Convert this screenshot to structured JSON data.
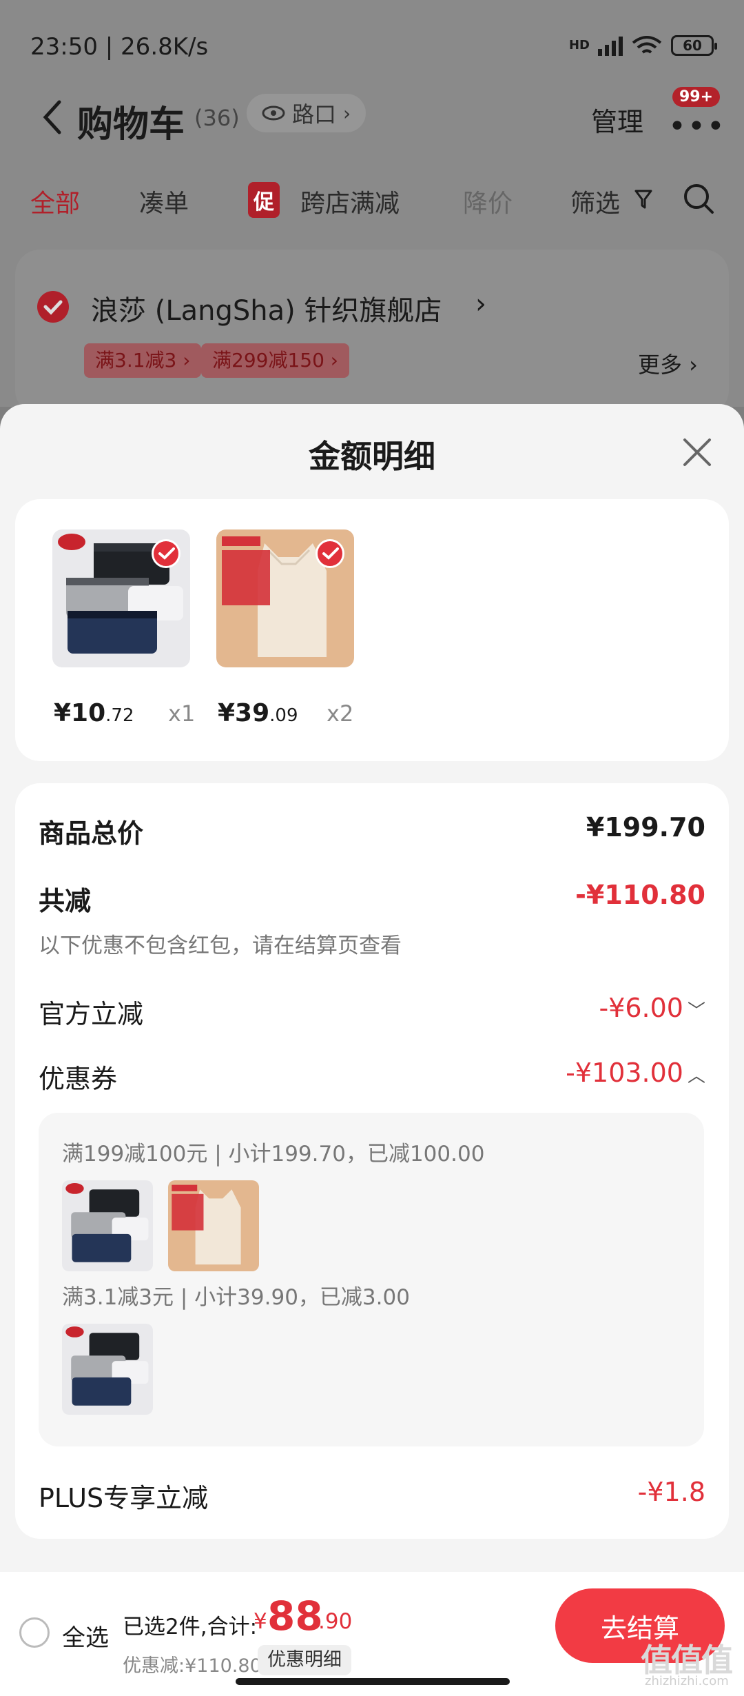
{
  "status": {
    "time_speed": "23:50 | 26.8K/s",
    "hd": "HD",
    "battery": "60"
  },
  "header": {
    "title": "购物车",
    "count": "(36)",
    "location": "路口",
    "manage": "管理",
    "badge": "99+"
  },
  "filters": {
    "all": "全部",
    "combine": "凑单",
    "promo_icon": "促",
    "promo": "跨店满减",
    "price_drop": "降价",
    "filter": "筛选"
  },
  "shop": {
    "name": "浪莎 (LangSha) 针织旗舰店",
    "coupons": [
      "满3.1减3 ›",
      "满299减150 ›"
    ],
    "more": "更多 ›"
  },
  "sheet": {
    "title": "金额明细",
    "products": [
      {
        "price_int": "¥10",
        "price_dec": ".72",
        "qty": "x1"
      },
      {
        "price_int": "¥39",
        "price_dec": ".09",
        "qty": "x2"
      }
    ],
    "total_label": "商品总价",
    "total_value": "¥199.70",
    "discount_label": "共减",
    "discount_value": "-¥110.80",
    "discount_note": "以下优惠不包含红包，请在结算页查看",
    "official_label": "官方立减",
    "official_value": "-¥6.00",
    "coupon_label": "优惠券",
    "coupon_value": "-¥103.00",
    "coupon_rule_1": "满199减100元 | 小计199.70，已减100.00",
    "coupon_rule_2": "满3.1减3元 | 小计39.90，已减3.00",
    "plus_label": "PLUS专享立减",
    "plus_value": "-¥1.8"
  },
  "bottom": {
    "select_all": "全选",
    "selected": "已选2件,合计:",
    "currency": "¥",
    "total_int": "88",
    "total_dec": ".90",
    "discount_line": "优惠减:¥110.80",
    "detail_link": "优惠明细",
    "checkout": "去结算"
  },
  "watermark": {
    "main": "值值值",
    "sub": "zhizhizhi.com"
  },
  "colors": {
    "accent_red": "#e1303a",
    "checkout": "#f23b44"
  }
}
